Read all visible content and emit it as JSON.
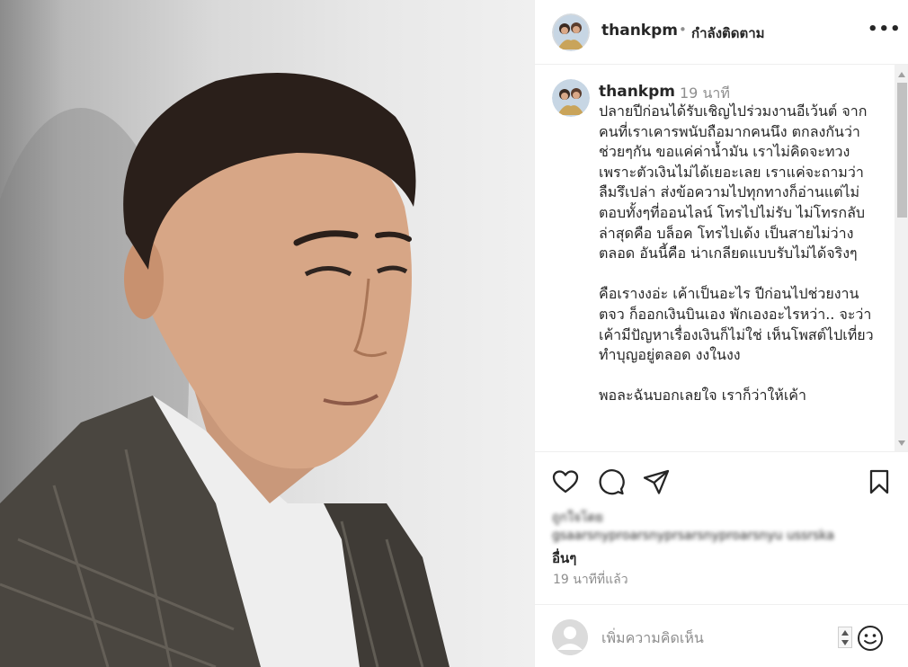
{
  "post": {
    "username": "thankpm",
    "follow_status": "กำลังติดตาม",
    "separator": "•",
    "more_label": "•••"
  },
  "caption": {
    "username": "thankpm",
    "time": "19 นาที",
    "text": "ปลายปีก่อนได้รับเชิญไปร่วมงานอีเว้นต์ จากคนที่เราเคารพนับถือมากคนนึง ตกลงกันว่าช่วยๆกัน ขอแค่ค่าน้ำมัน เราไม่คิดจะทวง เพราะตัวเงินไม่ได้เยอะเลย เราแค่จะถามว่าลืมรึเปล่า ส่งข้อความไปทุกทางก็อ่านแต่ไม่ตอบทั้งๆที่ออนไลน์ โทรไปไม่รับ ไม่โทรกลับ ล่าสุดคือ บล็อค โทรไปเด้ง เป็นสายไม่ว่างตลอด อันนี้คือ น่าเกลียดแบบรับไม่ได้จริงๆ\n\nคือเรางงอ่ะ เค้าเป็นอะไร ปีก่อนไปช่วยงาน ตจว ก็ออกเงินบินเอง พักเองอะไรหว่า.. จะว่าเค้ามีปัญหาเรื่องเงินก็ไม่ใช่ เห็นโพสต์ไปเที่ยว ทำบุญอยู่ตลอด งงในงง\n\nพอละฉันบอกเลยใจ เราก็ว่าให้เค้า"
  },
  "liked_by": {
    "label": "ถูกใจโดย",
    "names": "gsaarsnyproarsnyprsarsnyproarsnyu ussrska",
    "rest": "อื่นๆ"
  },
  "timestamp": "19 นาทีที่แล้ว",
  "comment": {
    "placeholder": "เพิ่มความคิดเห็น"
  },
  "icons": {
    "like": "heart-icon",
    "comment": "comment-icon",
    "share": "send-icon",
    "save": "bookmark-icon",
    "emoji": "smiley-icon"
  }
}
